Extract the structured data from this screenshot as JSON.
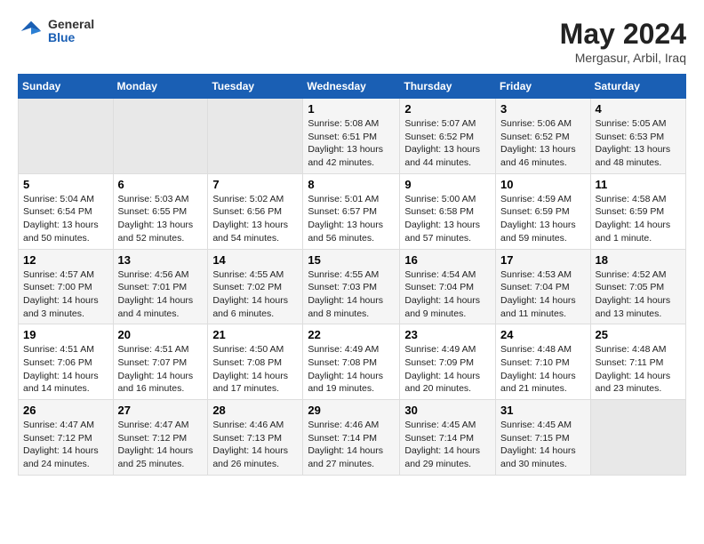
{
  "header": {
    "logo_general": "General",
    "logo_blue": "Blue",
    "title": "May 2024",
    "location": "Mergasur, Arbil, Iraq"
  },
  "days_of_week": [
    "Sunday",
    "Monday",
    "Tuesday",
    "Wednesday",
    "Thursday",
    "Friday",
    "Saturday"
  ],
  "rows": [
    [
      {
        "day": "",
        "sunrise": "",
        "sunset": "",
        "daylight": ""
      },
      {
        "day": "",
        "sunrise": "",
        "sunset": "",
        "daylight": ""
      },
      {
        "day": "",
        "sunrise": "",
        "sunset": "",
        "daylight": ""
      },
      {
        "day": "1",
        "sunrise": "5:08 AM",
        "sunset": "6:51 PM",
        "daylight": "13 hours and 42 minutes."
      },
      {
        "day": "2",
        "sunrise": "5:07 AM",
        "sunset": "6:52 PM",
        "daylight": "13 hours and 44 minutes."
      },
      {
        "day": "3",
        "sunrise": "5:06 AM",
        "sunset": "6:52 PM",
        "daylight": "13 hours and 46 minutes."
      },
      {
        "day": "4",
        "sunrise": "5:05 AM",
        "sunset": "6:53 PM",
        "daylight": "13 hours and 48 minutes."
      }
    ],
    [
      {
        "day": "5",
        "sunrise": "5:04 AM",
        "sunset": "6:54 PM",
        "daylight": "13 hours and 50 minutes."
      },
      {
        "day": "6",
        "sunrise": "5:03 AM",
        "sunset": "6:55 PM",
        "daylight": "13 hours and 52 minutes."
      },
      {
        "day": "7",
        "sunrise": "5:02 AM",
        "sunset": "6:56 PM",
        "daylight": "13 hours and 54 minutes."
      },
      {
        "day": "8",
        "sunrise": "5:01 AM",
        "sunset": "6:57 PM",
        "daylight": "13 hours and 56 minutes."
      },
      {
        "day": "9",
        "sunrise": "5:00 AM",
        "sunset": "6:58 PM",
        "daylight": "13 hours and 57 minutes."
      },
      {
        "day": "10",
        "sunrise": "4:59 AM",
        "sunset": "6:59 PM",
        "daylight": "13 hours and 59 minutes."
      },
      {
        "day": "11",
        "sunrise": "4:58 AM",
        "sunset": "6:59 PM",
        "daylight": "14 hours and 1 minute."
      }
    ],
    [
      {
        "day": "12",
        "sunrise": "4:57 AM",
        "sunset": "7:00 PM",
        "daylight": "14 hours and 3 minutes."
      },
      {
        "day": "13",
        "sunrise": "4:56 AM",
        "sunset": "7:01 PM",
        "daylight": "14 hours and 4 minutes."
      },
      {
        "day": "14",
        "sunrise": "4:55 AM",
        "sunset": "7:02 PM",
        "daylight": "14 hours and 6 minutes."
      },
      {
        "day": "15",
        "sunrise": "4:55 AM",
        "sunset": "7:03 PM",
        "daylight": "14 hours and 8 minutes."
      },
      {
        "day": "16",
        "sunrise": "4:54 AM",
        "sunset": "7:04 PM",
        "daylight": "14 hours and 9 minutes."
      },
      {
        "day": "17",
        "sunrise": "4:53 AM",
        "sunset": "7:04 PM",
        "daylight": "14 hours and 11 minutes."
      },
      {
        "day": "18",
        "sunrise": "4:52 AM",
        "sunset": "7:05 PM",
        "daylight": "14 hours and 13 minutes."
      }
    ],
    [
      {
        "day": "19",
        "sunrise": "4:51 AM",
        "sunset": "7:06 PM",
        "daylight": "14 hours and 14 minutes."
      },
      {
        "day": "20",
        "sunrise": "4:51 AM",
        "sunset": "7:07 PM",
        "daylight": "14 hours and 16 minutes."
      },
      {
        "day": "21",
        "sunrise": "4:50 AM",
        "sunset": "7:08 PM",
        "daylight": "14 hours and 17 minutes."
      },
      {
        "day": "22",
        "sunrise": "4:49 AM",
        "sunset": "7:08 PM",
        "daylight": "14 hours and 19 minutes."
      },
      {
        "day": "23",
        "sunrise": "4:49 AM",
        "sunset": "7:09 PM",
        "daylight": "14 hours and 20 minutes."
      },
      {
        "day": "24",
        "sunrise": "4:48 AM",
        "sunset": "7:10 PM",
        "daylight": "14 hours and 21 minutes."
      },
      {
        "day": "25",
        "sunrise": "4:48 AM",
        "sunset": "7:11 PM",
        "daylight": "14 hours and 23 minutes."
      }
    ],
    [
      {
        "day": "26",
        "sunrise": "4:47 AM",
        "sunset": "7:12 PM",
        "daylight": "14 hours and 24 minutes."
      },
      {
        "day": "27",
        "sunrise": "4:47 AM",
        "sunset": "7:12 PM",
        "daylight": "14 hours and 25 minutes."
      },
      {
        "day": "28",
        "sunrise": "4:46 AM",
        "sunset": "7:13 PM",
        "daylight": "14 hours and 26 minutes."
      },
      {
        "day": "29",
        "sunrise": "4:46 AM",
        "sunset": "7:14 PM",
        "daylight": "14 hours and 27 minutes."
      },
      {
        "day": "30",
        "sunrise": "4:45 AM",
        "sunset": "7:14 PM",
        "daylight": "14 hours and 29 minutes."
      },
      {
        "day": "31",
        "sunrise": "4:45 AM",
        "sunset": "7:15 PM",
        "daylight": "14 hours and 30 minutes."
      },
      {
        "day": "",
        "sunrise": "",
        "sunset": "",
        "daylight": ""
      }
    ]
  ]
}
